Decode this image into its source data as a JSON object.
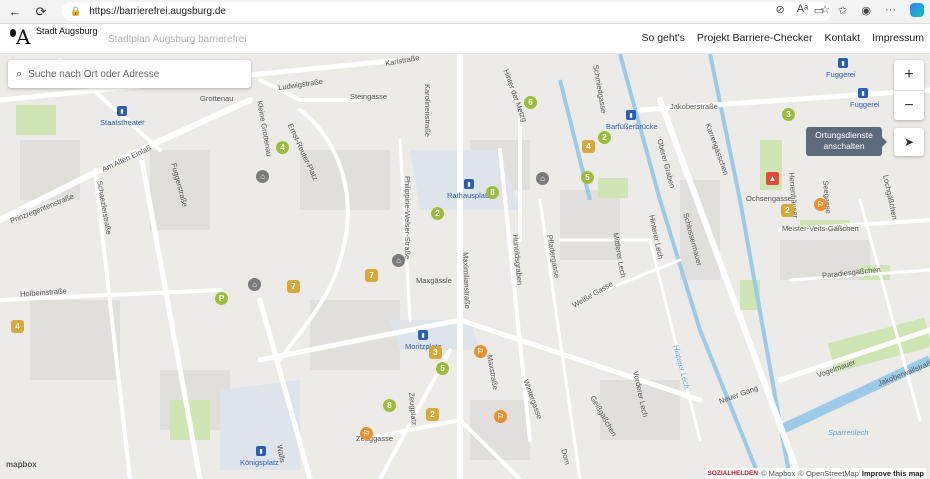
{
  "browser": {
    "url": "https://barrierefrei.augsburg.de"
  },
  "site": {
    "city_name": "Stadt Augsburg",
    "logo_letter": "A",
    "title": "Stadtplan Augsburg barrierefrei",
    "nav": [
      "So geht's",
      "Projekt Barriere-Checker",
      "Kontakt",
      "Impressum"
    ]
  },
  "search": {
    "placeholder": "Suche nach Ort oder Adresse"
  },
  "map_controls": {
    "zoom_in": "+",
    "zoom_out": "−",
    "locate_tooltip_line1": "Ortungsdienste",
    "locate_tooltip_line2": "anschalten"
  },
  "attribution": {
    "sozialhelden": "SOZIALHELDEN",
    "mapbox": "© Mapbox",
    "osm": "© OpenStreetMap",
    "improve": "Improve this map",
    "mapbox_logo": "mapbox"
  },
  "streets": [
    {
      "name": "Ludwigstraße",
      "key": "ludwig"
    },
    {
      "name": "Grottenau",
      "key": "grottenau"
    },
    {
      "name": "Karlstraße",
      "key": "karl"
    },
    {
      "name": "Steingasse",
      "key": "stein"
    },
    {
      "name": "Karolinenstraße",
      "key": "karolinen"
    },
    {
      "name": "Hinter der Metzg",
      "key": "metzg"
    },
    {
      "name": "Schmiedgasse",
      "key": "schmied"
    },
    {
      "name": "Jakoberstraße",
      "key": "jakober"
    },
    {
      "name": "Kleine Grottenau",
      "key": "kleine"
    },
    {
      "name": "Ernst-Reuter-Platz",
      "key": "ernst"
    },
    {
      "name": "Am Alten Einlaß",
      "key": "einlass"
    },
    {
      "name": "Fuggerstraße",
      "key": "fugger"
    },
    {
      "name": "Prinzregentenstraße",
      "key": "prinz"
    },
    {
      "name": "Schaezlerstraße",
      "key": "schaezler"
    },
    {
      "name": "Philippine-Welser-Straße",
      "key": "welser"
    },
    {
      "name": "Maximilianstraße",
      "key": "maxi"
    },
    {
      "name": "Hunoldsgraben",
      "key": "hunolds"
    },
    {
      "name": "Pfladergasse",
      "key": "pflader"
    },
    {
      "name": "Weiße Gasse",
      "key": "weisse"
    },
    {
      "name": "Mittlerer Lech",
      "key": "mlech"
    },
    {
      "name": "Hinterer Lech",
      "key": "hlech"
    },
    {
      "name": "Schlossermauer",
      "key": "schlosser"
    },
    {
      "name": "Oberer Graben",
      "key": "obgraben"
    },
    {
      "name": "Karrengässchen",
      "key": "karren"
    },
    {
      "name": "Herrenhäuser",
      "key": "herren"
    },
    {
      "name": "Ochsengasse",
      "key": "ochsen"
    },
    {
      "name": "Meister-Veits-Gäßchen",
      "key": "veits"
    },
    {
      "name": "Paradiesgäßchen",
      "key": "paradies"
    },
    {
      "name": "Lochgäßchen",
      "key": "loch"
    },
    {
      "name": "Holbeinstraße",
      "key": "holbein"
    },
    {
      "name": "Maxgässle",
      "key": "maxg"
    },
    {
      "name": "Wintergasse",
      "key": "winter"
    },
    {
      "name": "Zeuggasse",
      "key": "zeug"
    },
    {
      "name": "Vorderer Lech",
      "key": "vlech"
    },
    {
      "name": "Geißgäßchen",
      "key": "geiss"
    },
    {
      "name": "Neuer Gang",
      "key": "neuer"
    },
    {
      "name": "Vogelmauer",
      "key": "vogel"
    },
    {
      "name": "Jakoberwallstraße",
      "key": "jakwall"
    },
    {
      "name": "Maxstraße",
      "key": "maxstr"
    },
    {
      "name": "Zeugplatz",
      "key": "zeugplatz"
    },
    {
      "name": "Seegasse",
      "key": "see"
    },
    {
      "name": "Dom",
      "key": "dom"
    },
    {
      "name": "Walls",
      "key": "walls"
    }
  ],
  "places": {
    "fuggerei": "Fuggerei",
    "staatstheater": "Staatstheater",
    "rathausplatz": "Rathausplatz",
    "barfuesser": "Barfüßerbrücke",
    "moritzplatz": "Moritzplatz",
    "koenigsplatz": "Königsplatz",
    "sparrenlech": "Sparrenlech",
    "hinterer_lech_water": "Hinterer Lech"
  },
  "markers": [
    {
      "label": "4",
      "color": "green"
    },
    {
      "label": "6",
      "color": "green"
    },
    {
      "label": "2",
      "color": "green"
    },
    {
      "label": "4",
      "color": "yellow"
    },
    {
      "label": "5",
      "color": "green"
    },
    {
      "label": "8",
      "color": "green"
    },
    {
      "label": "2",
      "color": "green"
    },
    {
      "label": "7",
      "color": "yellow"
    },
    {
      "label": "7",
      "color": "yellow"
    },
    {
      "label": "P",
      "color": "green"
    },
    {
      "label": "4",
      "color": "yellow"
    },
    {
      "label": "3",
      "color": "yellow"
    },
    {
      "label": "5",
      "color": "green"
    },
    {
      "label": "8",
      "color": "green"
    },
    {
      "label": "2",
      "color": "yellow"
    },
    {
      "label": "3",
      "color": "green"
    },
    {
      "label": "2",
      "color": "yellow"
    }
  ]
}
